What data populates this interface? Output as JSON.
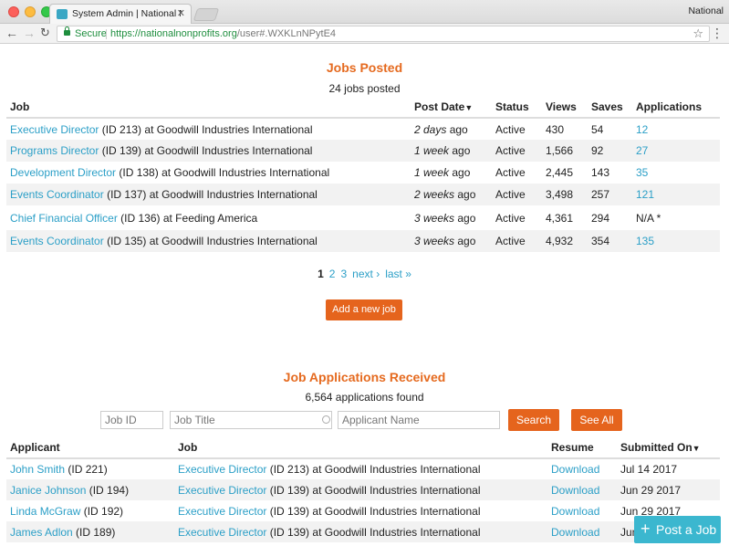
{
  "browser": {
    "tab_title": "System Admin | National Nonprofits",
    "tab_close": "✕",
    "profile": "National",
    "secure_label": "Secure",
    "url_host": "https://nationalnonprofits.org",
    "url_path": "/user#.WXKLnNPytE4"
  },
  "jobs": {
    "title": "Jobs Posted",
    "count_text": "24 jobs posted",
    "headers": {
      "job": "Job",
      "post_date": "Post Date",
      "status": "Status",
      "views": "Views",
      "saves": "Saves",
      "applications": "Applications"
    },
    "rows": [
      {
        "title": "Executive Director",
        "rest": " (ID 213) at Goodwill Industries International",
        "date_i": "2 days",
        "date_ago": " ago",
        "status": "Active",
        "views": "430",
        "saves": "54",
        "apps": "12"
      },
      {
        "title": "Programs Director",
        "rest": " (ID 139) at Goodwill Industries International",
        "date_i": "1 week",
        "date_ago": " ago",
        "status": "Active",
        "views": "1,566",
        "saves": "92",
        "apps": "27"
      },
      {
        "title": "Development Director",
        "rest": " (ID 138) at Goodwill Industries International",
        "date_i": "1 week",
        "date_ago": " ago",
        "status": "Active",
        "views": "2,445",
        "saves": "143",
        "apps": "35"
      },
      {
        "title": "Events Coordinator",
        "rest": " (ID 137) at Goodwill Industries International",
        "date_i": "2 weeks",
        "date_ago": " ago",
        "status": "Active",
        "views": "3,498",
        "saves": "257",
        "apps": "121"
      },
      {
        "title": "Chief Financial Officer",
        "rest": " (ID 136) at Feeding America",
        "date_i": "3 weeks",
        "date_ago": " ago",
        "status": "Active",
        "views": "4,361",
        "saves": "294",
        "apps": "N/A *"
      },
      {
        "title": "Events Coordinator",
        "rest": " (ID 135) at Goodwill Industries International",
        "date_i": "3 weeks",
        "date_ago": " ago",
        "status": "Active",
        "views": "4,932",
        "saves": "354",
        "apps": "135"
      }
    ],
    "pager": {
      "current": "1",
      "p2": "2",
      "p3": "3",
      "next": "next ›",
      "last": "last »"
    },
    "add_button": "Add a new job"
  },
  "applications": {
    "title": "Job Applications Received",
    "count_text": "6,564 applications found",
    "filters": {
      "job_id_placeholder": "Job ID",
      "job_title_placeholder": "Job Title",
      "applicant_placeholder": "Applicant Name",
      "search_button": "Search",
      "see_all_button": "See All"
    },
    "headers": {
      "applicant": "Applicant",
      "job": "Job",
      "resume": "Resume",
      "submitted": "Submitted On"
    },
    "rows": [
      {
        "name": "John Smith",
        "name_id": " (ID 221)",
        "job": "Executive Director",
        "job_rest": " (ID 213) at Goodwill Industries International",
        "resume": "Download",
        "submitted": "Jul 14 2017"
      },
      {
        "name": "Janice Johnson",
        "name_id": " (ID 194)",
        "job": "Executive Director",
        "job_rest": " (ID 139) at Goodwill Industries International",
        "resume": "Download",
        "submitted": "Jun 29 2017"
      },
      {
        "name": "Linda McGraw",
        "name_id": " (ID 192)",
        "job": "Executive Director",
        "job_rest": " (ID 139) at Goodwill Industries International",
        "resume": "Download",
        "submitted": "Jun 29 2017"
      },
      {
        "name": "James Adlon",
        "name_id": " (ID 189)",
        "job": "Executive Director",
        "job_rest": " (ID 139) at Goodwill Industries International",
        "resume": "Download",
        "submitted": "Jun 28 2017"
      }
    ]
  },
  "post_job_button": "Post a Job",
  "colors": {
    "accent_orange": "#e5641d",
    "link_blue": "#2b9fc7",
    "title_orange": "#e56a1f",
    "post_button": "#3bb7cf"
  }
}
